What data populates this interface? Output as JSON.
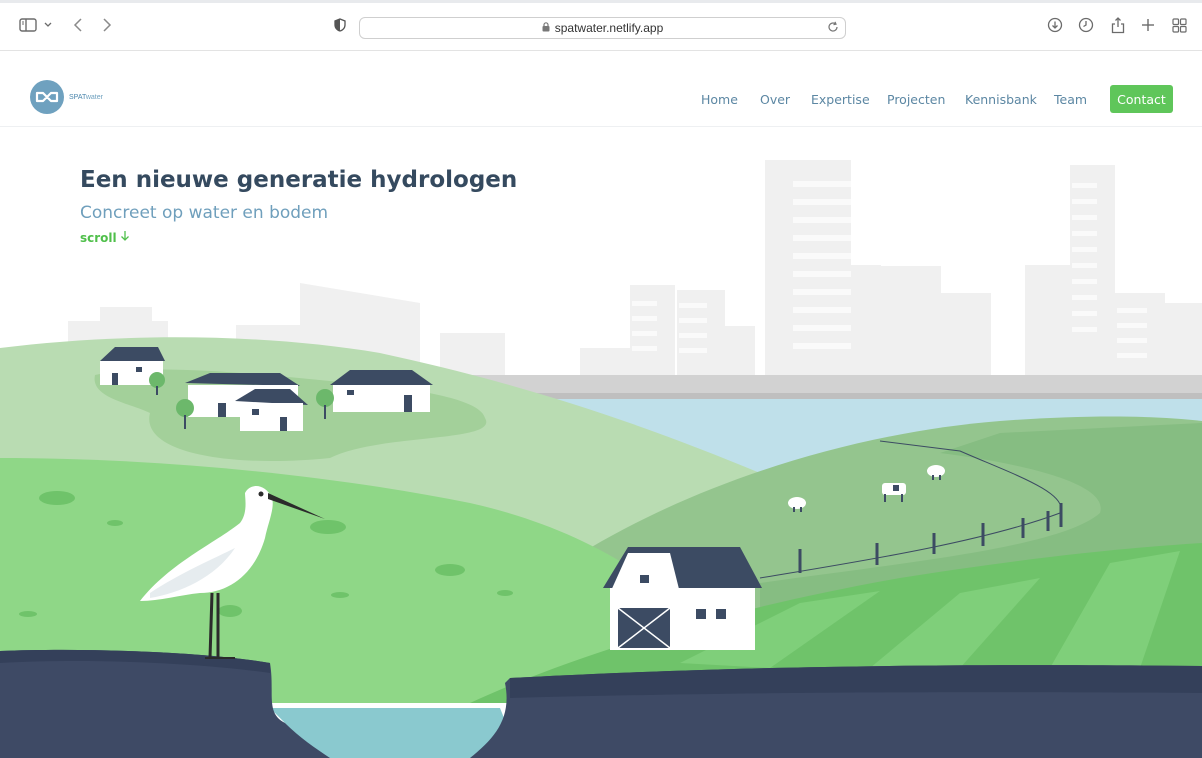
{
  "browser": {
    "url": "spatwater.netlify.app",
    "icons": [
      "sidebar-icon",
      "chevron-down-icon",
      "back-arrow-icon",
      "forward-arrow-icon",
      "privacy-shield-icon",
      "lock-icon",
      "reload-icon",
      "download-icon",
      "history-clock-icon",
      "share-icon",
      "new-tab-plus-icon",
      "tab-overview-grid-icon"
    ]
  },
  "site": {
    "logo_text_bold": "SPAT",
    "logo_text": "water",
    "brand_color": "#6fa1bf",
    "accent_color": "#5fc65a",
    "nav": [
      {
        "label": "Home"
      },
      {
        "label": "Over"
      },
      {
        "label": "Expertise"
      },
      {
        "label": "Projecten"
      },
      {
        "label": "Kennisbank"
      },
      {
        "label": "Team"
      }
    ],
    "contact_label": "Contact"
  },
  "hero": {
    "title": "Een nieuwe generatie hydrologen",
    "subtitle": "Concreet op water en bodem",
    "scroll_label": "scroll"
  }
}
